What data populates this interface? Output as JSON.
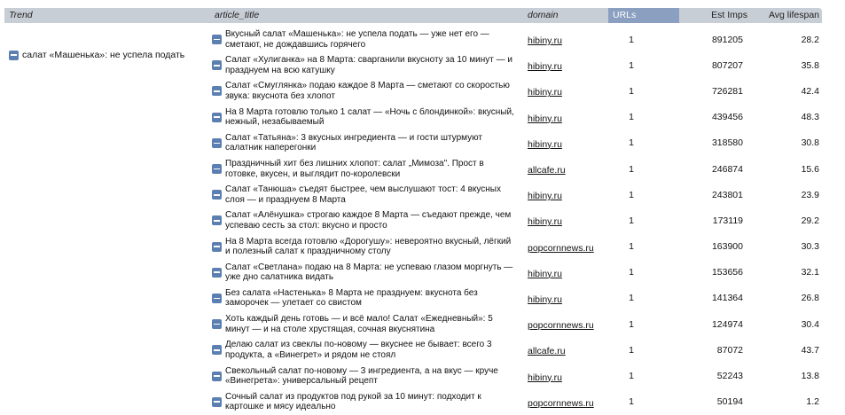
{
  "header": {
    "trend": "Trend",
    "article_title": "article_title",
    "domain": "domain",
    "urls": "URLs",
    "est_imps": "Est Imps",
    "avg_lifespan": "Avg lifespan"
  },
  "trend": {
    "label": "салат «Машенька»: не успела подать",
    "icon": "collapse-icon"
  },
  "rows": [
    {
      "title": "Вкусный салат «Машенька»: не успела подать — уже нет его — сметают, не дождавшись горячего",
      "domain": "hibiny.ru",
      "urls": "1",
      "imps": "891205",
      "life": "28.2"
    },
    {
      "title": "Салат «Хулиганка» на 8 Марта: сварганили вкусноту за 10 минут — и празднуем на всю катушку",
      "domain": "hibiny.ru",
      "urls": "1",
      "imps": "807207",
      "life": "35.8"
    },
    {
      "title": "Салат «Смуглянка» подаю каждое 8 Марта — сметают со скоростью звука: вкуснота без хлопот",
      "domain": "hibiny.ru",
      "urls": "1",
      "imps": "726281",
      "life": "42.4"
    },
    {
      "title": "На 8 Марта готовлю только 1 салат — «Ночь с блондинкой»: вкусный, нежный, незабываемый",
      "domain": "hibiny.ru",
      "urls": "1",
      "imps": "439456",
      "life": "48.3"
    },
    {
      "title": "Салат «Татьяна»: 3 вкусных ингредиента — и гости штурмуют салатник наперегонки",
      "domain": "hibiny.ru",
      "urls": "1",
      "imps": "318580",
      "life": "30.8"
    },
    {
      "title": "Праздничный хит без лишних хлопот: салат „Мимоза\". Прост в готовке, вкусен, и выглядит по-королевски",
      "domain": "allcafe.ru",
      "urls": "1",
      "imps": "246874",
      "life": "15.6"
    },
    {
      "title": "Салат «Танюша» съедят быстрее, чем выслушают тост: 4 вкусных слоя — и празднуем 8 Марта",
      "domain": "hibiny.ru",
      "urls": "1",
      "imps": "243801",
      "life": "23.9"
    },
    {
      "title": "Салат «Алёнушка» строгаю каждое 8 Марта — съедают прежде, чем успеваю сесть за стол: вкусно и просто",
      "domain": "hibiny.ru",
      "urls": "1",
      "imps": "173119",
      "life": "29.2"
    },
    {
      "title": "На 8 Марта всегда готовлю «Дорогушу»: невероятно вкусный, лёгкий и полезный салат к праздничному столу",
      "domain": "popcornnews.ru",
      "urls": "1",
      "imps": "163900",
      "life": "30.3"
    },
    {
      "title": "Салат «Светлана» подаю на 8 Марта: не успеваю глазом моргнуть — уже дно салатника видать",
      "domain": "hibiny.ru",
      "urls": "1",
      "imps": "153656",
      "life": "32.1"
    },
    {
      "title": "Без салата «Настенька» 8 Марта не празднуем: вкуснота без заморочек — улетает со свистом",
      "domain": "hibiny.ru",
      "urls": "1",
      "imps": "141364",
      "life": "26.8"
    },
    {
      "title": "Хоть каждый день готовь — и всё мало! Салат «Ежедневный»: 5 минут — и на столе хрустящая, сочная вкуснятина",
      "domain": "popcornnews.ru",
      "urls": "1",
      "imps": "124974",
      "life": "30.4"
    },
    {
      "title": "Делаю салат из свеклы по-новому — вкуснее не бывает: всего 3 продукта, а «Винегрет» и рядом не стоял",
      "domain": "allcafe.ru",
      "urls": "1",
      "imps": "87072",
      "life": "43.7"
    },
    {
      "title": "Свекольный салат по-новому — 3 ингредиента, а на вкус — круче «Винегрета»: универсальный рецепт",
      "domain": "hibiny.ru",
      "urls": "1",
      "imps": "52243",
      "life": "13.8"
    },
    {
      "title": "Сочный салат из продуктов под рукой за 10 минут: подходит к картошке и мясу идеально",
      "domain": "popcornnews.ru",
      "urls": "1",
      "imps": "50194",
      "life": "1.2"
    }
  ]
}
